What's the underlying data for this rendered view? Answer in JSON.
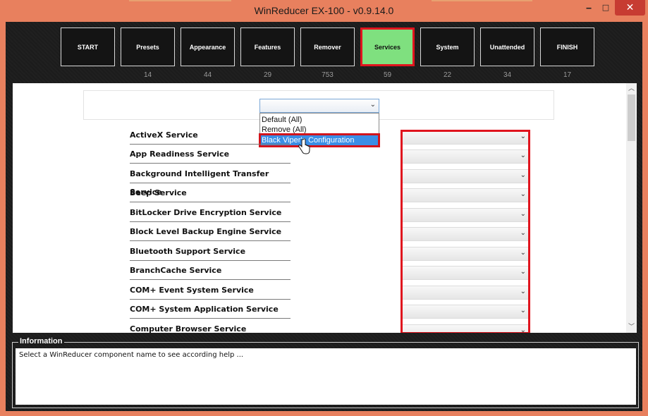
{
  "window": {
    "title": "WinReducer EX-100 - v0.9.14.0",
    "controls": {
      "minimize": "‒",
      "maximize": "□",
      "close": "✕"
    }
  },
  "tabs": [
    {
      "label": "START",
      "count": ""
    },
    {
      "label": "Presets",
      "count": "14"
    },
    {
      "label": "Appearance",
      "count": "44"
    },
    {
      "label": "Features",
      "count": "29"
    },
    {
      "label": "Remover",
      "count": "753"
    },
    {
      "label": "Services",
      "count": "59",
      "active": true
    },
    {
      "label": "System",
      "count": "22"
    },
    {
      "label": "Unattended",
      "count": "34"
    },
    {
      "label": "FINISH",
      "count": "17"
    }
  ],
  "preset_combo": {
    "selected": "",
    "options": [
      "Default (All)",
      "Remove (All)",
      "Black Viper's Configuration"
    ],
    "highlighted": "Black Viper's Configuration"
  },
  "services": [
    {
      "label": "ActiveX Service",
      "value": ""
    },
    {
      "label": "App Readiness Service",
      "value": ""
    },
    {
      "label": "Background Intelligent Transfer Service",
      "value": ""
    },
    {
      "label": "Beep Service",
      "value": ""
    },
    {
      "label": "BitLocker Drive Encryption Service",
      "value": ""
    },
    {
      "label": "Block Level Backup Engine Service",
      "value": ""
    },
    {
      "label": "Bluetooth Support Service",
      "value": ""
    },
    {
      "label": "BranchCache Service",
      "value": ""
    },
    {
      "label": "COM+ Event System Service",
      "value": ""
    },
    {
      "label": "COM+ System Application Service",
      "value": ""
    },
    {
      "label": "Computer Browser Service",
      "value": ""
    }
  ],
  "information": {
    "title": "Information",
    "text": "Select a WinReducer component name to see according help ..."
  },
  "colors": {
    "frame": "#e8805e",
    "active_tab": "#7fe07f",
    "highlight": "#e0141e",
    "selection": "#3a8ee6"
  }
}
